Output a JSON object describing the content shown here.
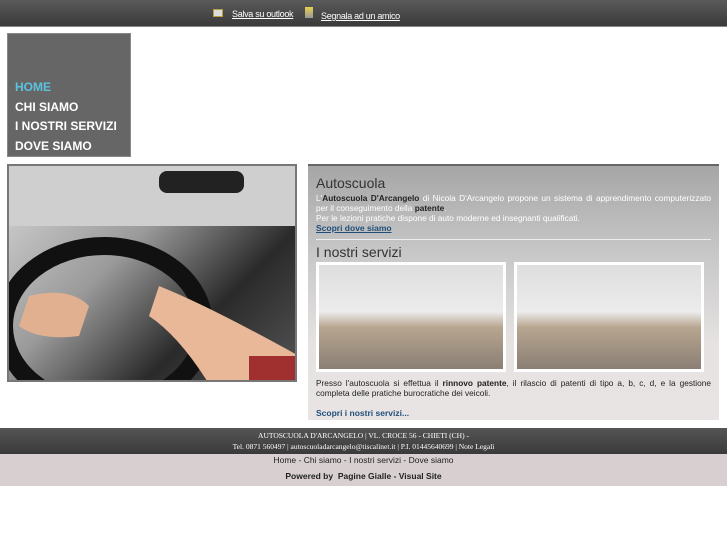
{
  "topbar": {
    "save_outlook": "Salva su outlook",
    "signal_friend": "Segnala ad un amico",
    "icons": [
      "outlook-card-icon",
      "friend-icon"
    ]
  },
  "nav": {
    "items": [
      {
        "label": "HOME",
        "active": true
      },
      {
        "label": "CHI SIAMO"
      },
      {
        "label": "I NOSTRI SERVIZI"
      },
      {
        "label": "DOVE SIAMO"
      }
    ],
    "active_color": "#5bc3e0"
  },
  "main": {
    "title1": "Autoscuola",
    "intro_prefix": "L'",
    "intro_bold": "Autoscuola D'Arcangelo",
    "intro_rest": " di Nicola D'Arcangelo propone un sistema di apprendimento computerizzato per il conseguimento della ",
    "intro_bold2": "patente",
    "intro_end": ".",
    "intro_line2": "Per le lezioni pratiche dispone di auto moderne ed insegnanti qualificati.",
    "link1": "Scopri dove siamo",
    "title2": "I nostri servizi",
    "services_prefix": "Presso l'autoscuola si effettua il ",
    "services_bold": "rinnovo patente",
    "services_rest": ", il rilascio di patenti di tipo a, b, c, d, e la gestione completa delle pratiche burocratiche dei veicoli.",
    "link2": "Scopri i nostri servizi..."
  },
  "footer": {
    "line1": "AUTOSCUOLA D'ARCANGELO | VL. CROCE 56 - CHIETI (CH) -",
    "tel": "Tel. 0871 560497",
    "email": "autoscuoladarcangelo@tiscalinet.it",
    "piva": "P.I. 01445640699",
    "legal": "Note Legali"
  },
  "bottom": {
    "home": "Home",
    "chi": "Chi siamo",
    "servizi": "I nostri servizi",
    "dove": "Dove siamo",
    "powered": "Powered by",
    "pg": "Pagine Gialle",
    "vs": "Visual Site"
  }
}
